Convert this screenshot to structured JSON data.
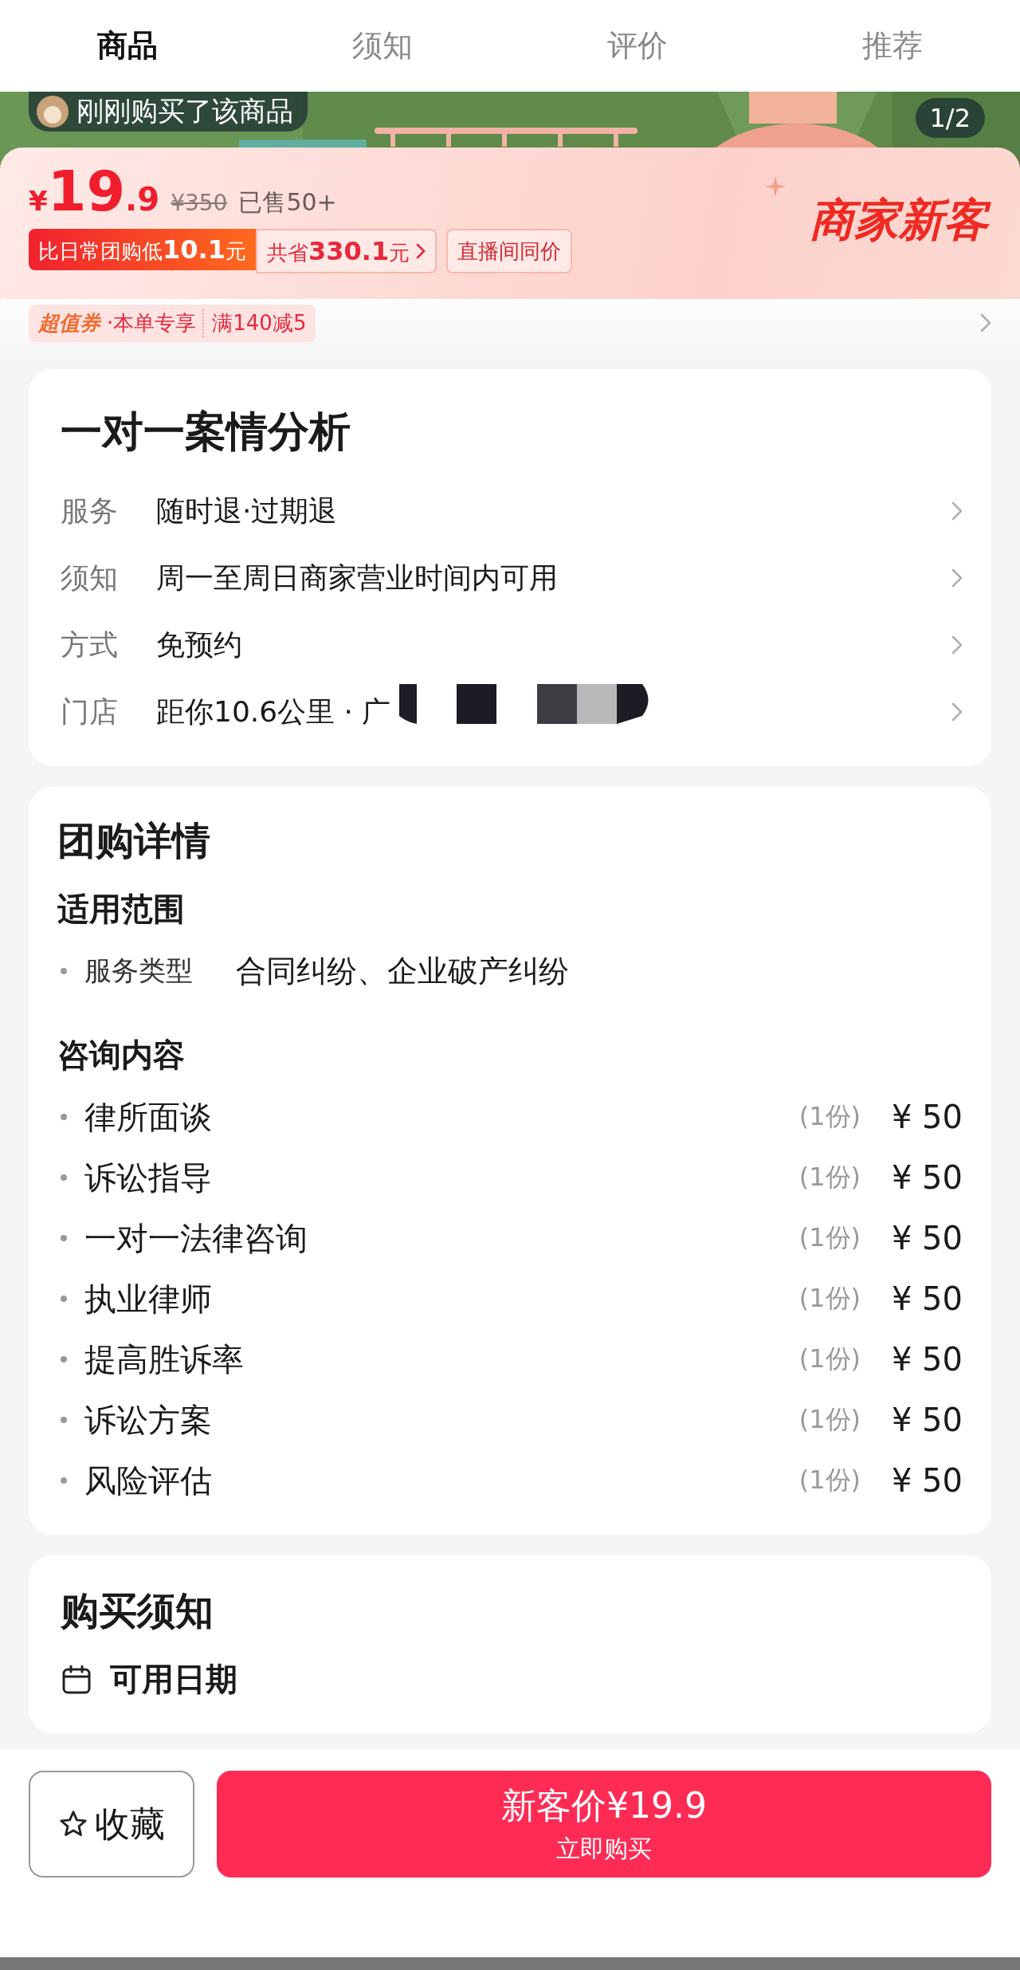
{
  "tabs": [
    {
      "label": "商品",
      "selected": true
    },
    {
      "label": "须知",
      "selected": false
    },
    {
      "label": "评价",
      "selected": false
    },
    {
      "label": "推荐",
      "selected": false
    }
  ],
  "banner": {
    "kind": "picture",
    "buyer_notice": "刚刚购买了该商品",
    "page_counter": "1/2"
  },
  "price": {
    "currency": "¥",
    "integer": "19",
    "decimal": ".9",
    "original": "¥350",
    "sold": "已售50+",
    "promo": "商家新客",
    "badges": [
      {
        "kind": "highlight",
        "text": "比日常团购低**10.1**元"
      },
      {
        "kind": "link",
        "text": "共省**330.1**元"
      },
      {
        "kind": "plain",
        "text": "直播间同价"
      }
    ]
  },
  "coupon": {
    "brand": "超值券",
    "scope": "·本单专享",
    "deal": "满140减5"
  },
  "service": {
    "title": "一对一案情分析",
    "rows": [
      {
        "label": "服务",
        "value": "随时退·过期退",
        "redacted": false
      },
      {
        "label": "须知",
        "value": "周一至周日商家营业时间内可用",
        "redacted": false
      },
      {
        "label": "方式",
        "value": "免预约",
        "redacted": false
      },
      {
        "label": "门店",
        "value": "距你10.6公里 · 广",
        "redacted": true
      }
    ]
  },
  "details": {
    "title": "团购详情",
    "sections": [
      {
        "heading": "适用范围",
        "items": [
          {
            "kind": "pair",
            "name": "服务类型",
            "value": "合同纠纷、企业破产纠纷"
          }
        ]
      },
      {
        "heading": "咨询内容",
        "items": [
          {
            "kind": "priced",
            "name": "律所面谈",
            "qty": "(1份)",
            "price": "¥ 50"
          },
          {
            "kind": "priced",
            "name": "诉讼指导",
            "qty": "(1份)",
            "price": "¥ 50"
          },
          {
            "kind": "priced",
            "name": "一对一法律咨询",
            "qty": "(1份)",
            "price": "¥ 50"
          },
          {
            "kind": "priced",
            "name": "执业律师",
            "qty": "(1份)",
            "price": "¥ 50"
          },
          {
            "kind": "priced",
            "name": "提高胜诉率",
            "qty": "(1份)",
            "price": "¥ 50"
          },
          {
            "kind": "priced",
            "name": "诉讼方案",
            "qty": "(1份)",
            "price": "¥ 50"
          },
          {
            "kind": "priced",
            "name": "风险评估",
            "qty": "(1份)",
            "price": "¥ 50"
          }
        ]
      }
    ]
  },
  "notice": {
    "title": "购买须知",
    "items": [
      {
        "label": "可用日期"
      }
    ]
  },
  "bottom_bar": {
    "favorite": "收藏",
    "buy_price": "新客价¥19.9",
    "buy_action": "立即购买"
  }
}
